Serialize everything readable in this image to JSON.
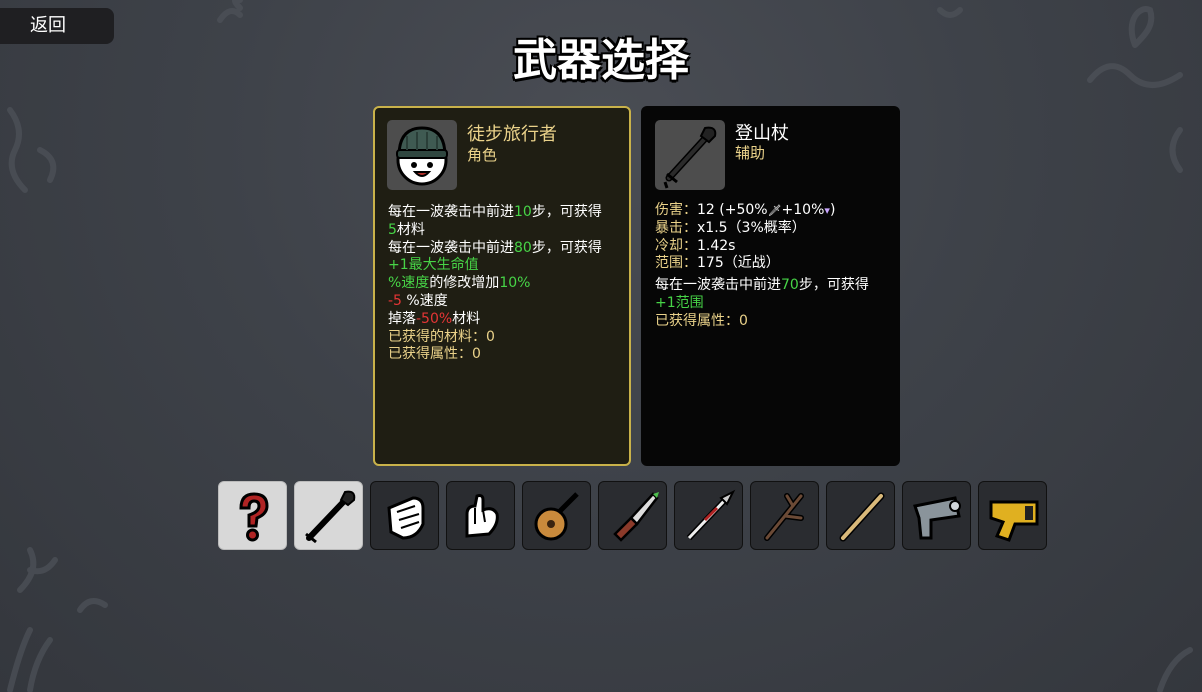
{
  "back_label": "返回",
  "page_title": "武器选择",
  "character_card": {
    "name": "徒步旅行者",
    "type": "角色",
    "icon": "hiker-character-icon",
    "lines": [
      {
        "a": "每在一波袭击中前进",
        "b": "10",
        "c": "步，可获得"
      },
      {
        "a": "5",
        "b": "材料"
      },
      {
        "a": "每在一波袭击中前进",
        "b": "80",
        "c": "步，可获得"
      },
      {
        "a": "+1最大生命值"
      },
      {
        "a": "%速度",
        "b": "的修改增加",
        "c": "10%"
      },
      {
        "a": "-5",
        "b": " %速度"
      },
      {
        "a": "掉落",
        "b": "-50%",
        "c": "材料"
      },
      {
        "a": "已获得的材料：0"
      },
      {
        "a": "已获得属性：0"
      }
    ]
  },
  "weapon_card": {
    "name": "登山杖",
    "type": "辅助",
    "icon": "hiking-pole-icon",
    "stats": [
      {
        "label": "伤害：",
        "value": "12 (+50%",
        "extra": "+10%",
        "end": ")"
      },
      {
        "label": "暴击：",
        "value": "x1.5（3%概率）"
      },
      {
        "label": "冷却：",
        "value": "1.42s"
      },
      {
        "label": "范围：",
        "value": "175（近战）"
      }
    ],
    "effect_a": "每在一波袭击中前进",
    "effect_b": "70",
    "effect_c": "步，可获得",
    "effect_bonus": "+1范围",
    "gained": "已获得属性：0"
  },
  "weapon_slots": [
    {
      "icon": "random-question-icon",
      "selected": false
    },
    {
      "icon": "hiking-pole-icon",
      "selected": true
    },
    {
      "icon": "fist-icon",
      "selected": false
    },
    {
      "icon": "hand-icon",
      "selected": false
    },
    {
      "icon": "lute-icon",
      "selected": false
    },
    {
      "icon": "knife-icon",
      "selected": false
    },
    {
      "icon": "spear-icon",
      "selected": false
    },
    {
      "icon": "branch-stick-icon",
      "selected": false
    },
    {
      "icon": "wooden-staff-icon",
      "selected": false
    },
    {
      "icon": "laser-gun-icon",
      "selected": false
    },
    {
      "icon": "taser-icon",
      "selected": false
    }
  ]
}
